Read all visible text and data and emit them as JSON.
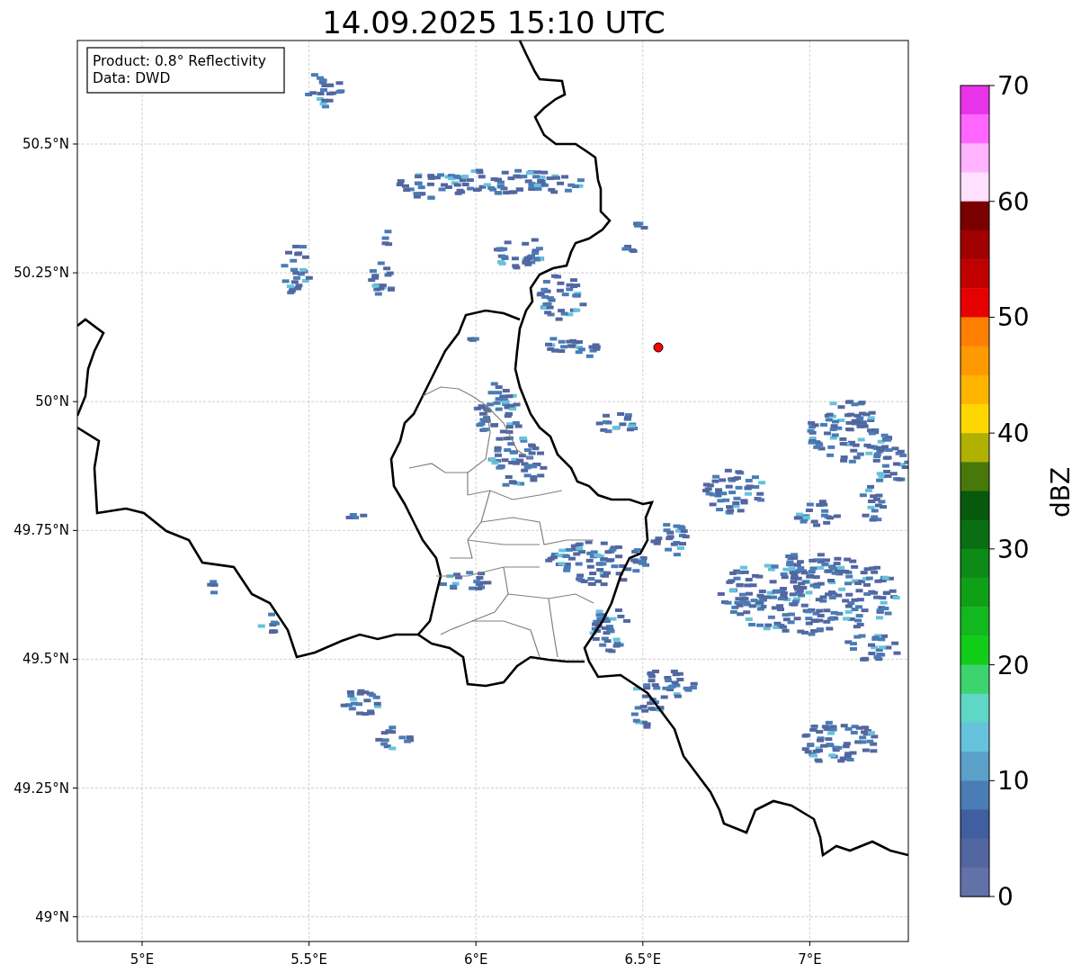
{
  "title": "14.09.2025 15:10 UTC",
  "annotation": [
    "Product: 0.8° Reflectivity",
    "Data: DWD"
  ],
  "map": {
    "x_ticks": [
      "5°E",
      "5.5°E",
      "6°E",
      "6.5°E",
      "7°E"
    ],
    "y_ticks": [
      "50.5°N",
      "50.25°N",
      "50°N",
      "49.75°N",
      "49.5°N",
      "49.25°N",
      "49°N"
    ]
  },
  "colorbar": {
    "label": "dBZ",
    "ticks": [
      "70",
      "60",
      "50",
      "40",
      "30",
      "20",
      "10",
      "0"
    ],
    "bands": [
      {
        "color": "#e833e8"
      },
      {
        "color": "#ff66ff"
      },
      {
        "color": "#ffb3ff"
      },
      {
        "color": "#ffe0ff"
      },
      {
        "color": "#7a0000"
      },
      {
        "color": "#a00000"
      },
      {
        "color": "#c00000"
      },
      {
        "color": "#e60000"
      },
      {
        "color": "#ff7f00"
      },
      {
        "color": "#ff9900"
      },
      {
        "color": "#ffb400"
      },
      {
        "color": "#ffd700"
      },
      {
        "color": "#b0b000"
      },
      {
        "color": "#48780a"
      },
      {
        "color": "#075a0c"
      },
      {
        "color": "#0a6e12"
      },
      {
        "color": "#0e8a16"
      },
      {
        "color": "#10a018"
      },
      {
        "color": "#12b81e"
      },
      {
        "color": "#12cc1a"
      },
      {
        "color": "#3cd46e"
      },
      {
        "color": "#5fd6c6"
      },
      {
        "color": "#66c2dd"
      },
      {
        "color": "#5aa0c8"
      },
      {
        "color": "#4a7cb5"
      },
      {
        "color": "#415ea0"
      },
      {
        "color": "#5267a0"
      },
      {
        "color": "#6272a8"
      }
    ]
  }
}
